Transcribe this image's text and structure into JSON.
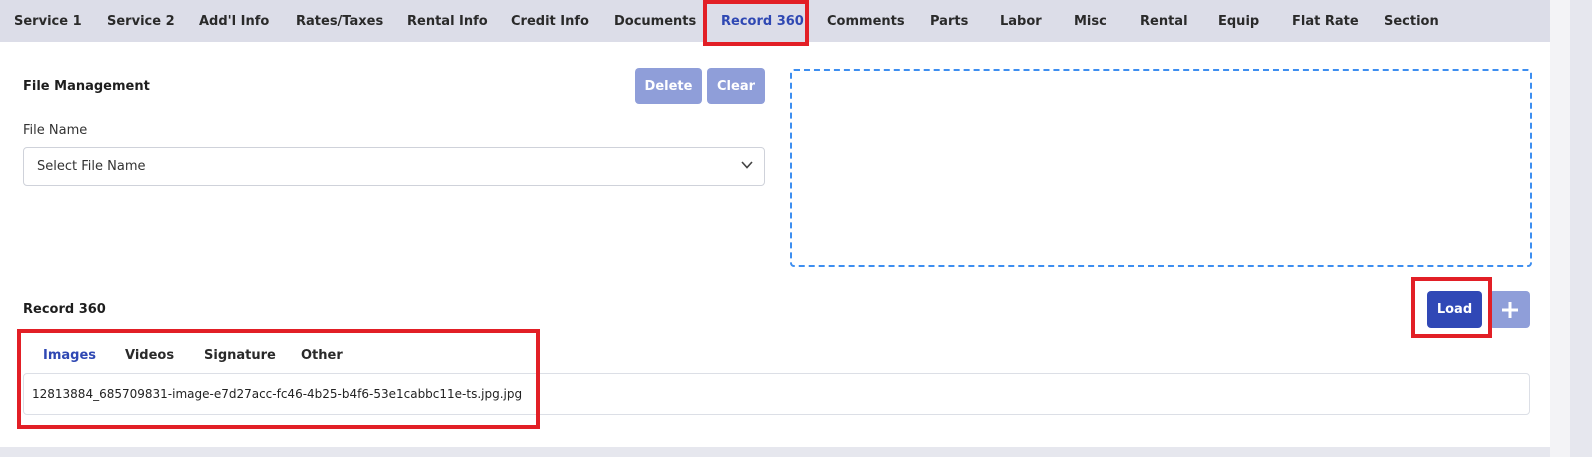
{
  "tabs": [
    {
      "label": "Service 1"
    },
    {
      "label": "Service 2"
    },
    {
      "label": "Add'l Info"
    },
    {
      "label": "Rates/Taxes"
    },
    {
      "label": "Rental Info"
    },
    {
      "label": "Credit Info"
    },
    {
      "label": "Documents"
    },
    {
      "label": "Record 360"
    },
    {
      "label": "Comments"
    },
    {
      "label": "Parts"
    },
    {
      "label": "Labor"
    },
    {
      "label": "Misc"
    },
    {
      "label": "Rental"
    },
    {
      "label": "Equip"
    },
    {
      "label": "Flat Rate"
    },
    {
      "label": "Section"
    }
  ],
  "active_tab": "Record 360",
  "file_management": {
    "title": "File Management",
    "delete_label": "Delete",
    "clear_label": "Clear",
    "file_name_label": "File Name",
    "select_placeholder": "Select File Name"
  },
  "record360": {
    "title": "Record 360",
    "load_label": "Load",
    "add_icon": "plus-icon",
    "subtabs": [
      {
        "label": "Images"
      },
      {
        "label": "Videos"
      },
      {
        "label": "Signature"
      },
      {
        "label": "Other"
      }
    ],
    "active_subtab": "Images",
    "file": "12813884_685709831-image-e7d27acc-fc46-4b25-b4f6-53e1cabbc11e-ts.jpg.jpg"
  },
  "colors": {
    "accent": "#2f48b3",
    "button_light": "#8f9ed9",
    "button_dark": "#3048b6",
    "highlight": "#e21f26",
    "dropzone_border": "#3d8ef0"
  }
}
